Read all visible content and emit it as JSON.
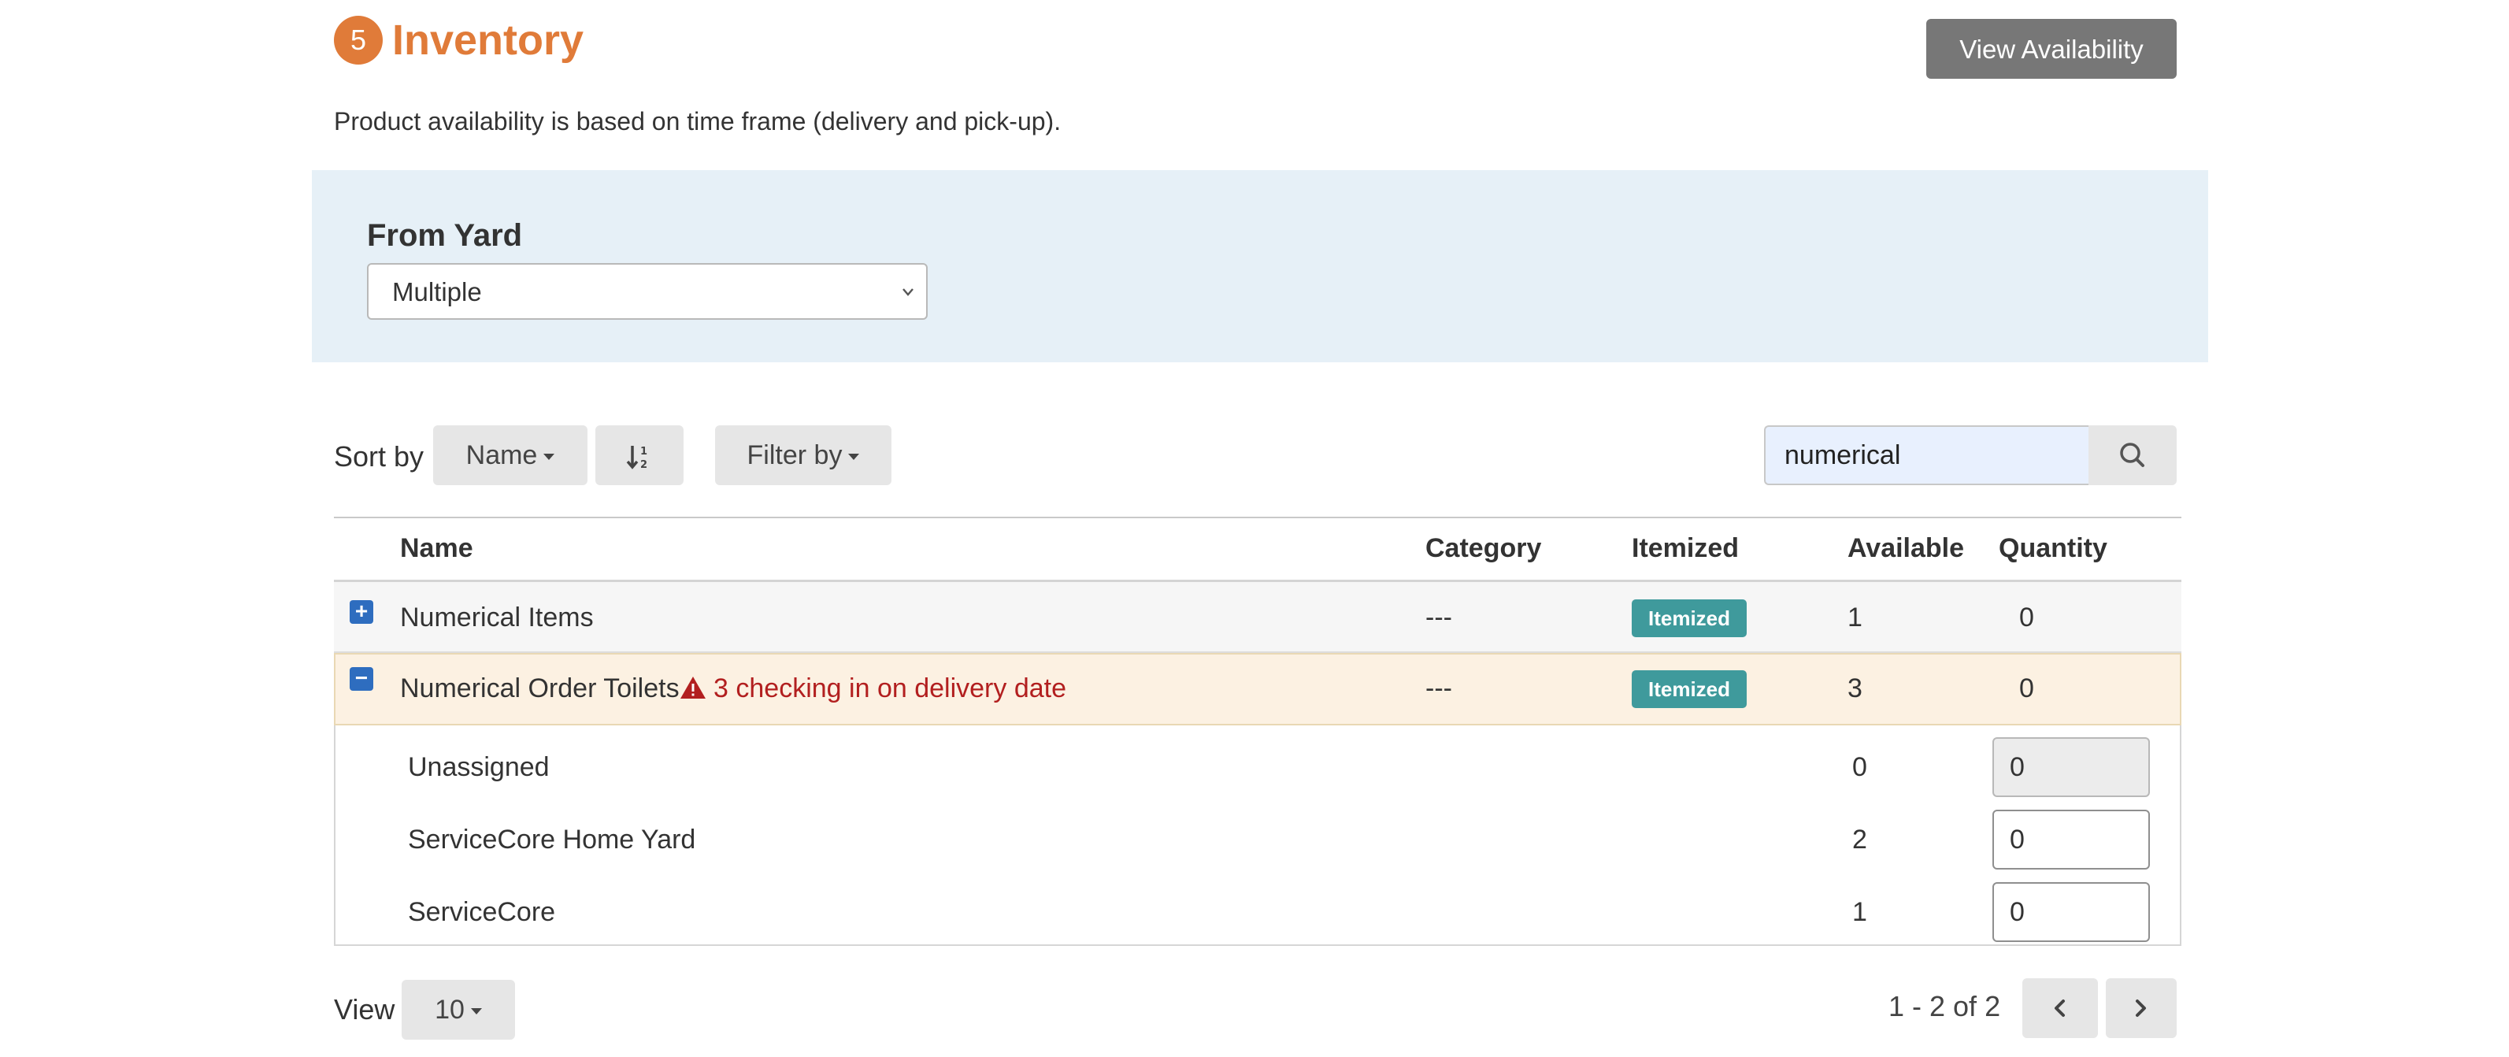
{
  "header": {
    "step_number": "5",
    "title": "Inventory",
    "view_availability_label": "View Availability",
    "subtitle": "Product availability is based on time frame (delivery and pick-up)."
  },
  "yard": {
    "label": "From Yard",
    "selected": "Multiple"
  },
  "toolbar": {
    "sort_by_label": "Sort by",
    "sort_field": "Name",
    "filter_label": "Filter by",
    "search_value": "numerical"
  },
  "table": {
    "columns": {
      "name": "Name",
      "category": "Category",
      "itemized": "Itemized",
      "available": "Available",
      "quantity": "Quantity"
    },
    "rows": [
      {
        "expander": "+",
        "name": "Numerical Items",
        "warning": "",
        "category": "---",
        "itemized": "Itemized",
        "available": "1",
        "quantity": "0"
      },
      {
        "expander": "−",
        "name": "Numerical Order Toilets",
        "warning": "3 checking in on delivery date",
        "category": "---",
        "itemized": "Itemized",
        "available": "3",
        "quantity": "0"
      }
    ],
    "subrows": [
      {
        "name": "Unassigned",
        "available": "0",
        "quantity": "0"
      },
      {
        "name": "ServiceCore Home Yard",
        "available": "2",
        "quantity": "0"
      },
      {
        "name": "ServiceCore",
        "available": "1",
        "quantity": "0"
      }
    ]
  },
  "footer": {
    "view_label": "View",
    "page_size": "10",
    "page_info": "1 - 2 of 2"
  },
  "colors": {
    "accent": "#e07b39",
    "badge": "#3f9a9c",
    "warning": "#b21f1f",
    "panel": "#e6f0f7",
    "expander": "#2e6dbf"
  }
}
